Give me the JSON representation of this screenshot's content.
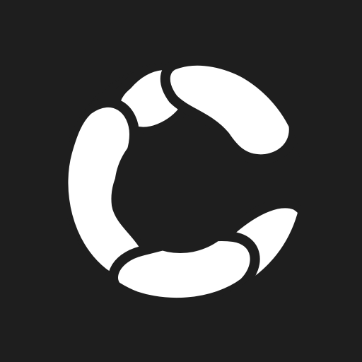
{
  "app_icon": {
    "icon": "ring-logo-icon",
    "background_color": "#1e1e1e",
    "foreground_color": "#ffffff",
    "segments": [
      "left-segment",
      "top-segment",
      "right-segment",
      "bottom-segment"
    ]
  }
}
